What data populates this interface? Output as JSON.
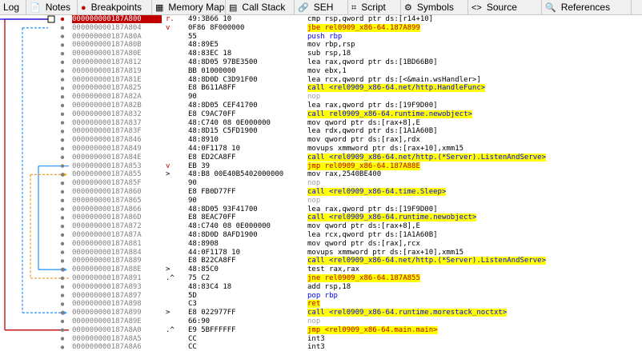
{
  "tabs": [
    {
      "label": "Log",
      "icon": "log-icon"
    },
    {
      "label": "Notes",
      "icon": "notes-icon"
    },
    {
      "label": "Breakpoints",
      "icon": "breakpoint-icon"
    },
    {
      "label": "Memory Map",
      "icon": "memory-map-icon"
    },
    {
      "label": "Call Stack",
      "icon": "call-stack-icon"
    },
    {
      "label": "SEH",
      "icon": "seh-icon"
    },
    {
      "label": "Script",
      "icon": "script-icon"
    },
    {
      "label": "Symbols",
      "icon": "symbols-icon"
    },
    {
      "label": "Source",
      "icon": "source-icon"
    },
    {
      "label": "References",
      "icon": "references-icon"
    }
  ],
  "rows": [
    {
      "addr": "000000000187A800",
      "mark": "r.",
      "bytes": "49:3B66 10",
      "instr": "cmp rsp,qword ptr ds:[r14+10]",
      "style": "cur"
    },
    {
      "addr": "000000000187A804",
      "mark": "v",
      "bytes": "0F86 8F000000",
      "instr": "jbe rel0909_x86-64.187A899",
      "style": "jcc"
    },
    {
      "addr": "000000000187A80A",
      "mark": "",
      "bytes": "55",
      "instr": "push rbp",
      "style": "blue"
    },
    {
      "addr": "000000000187A80B",
      "mark": "",
      "bytes": "48:89E5",
      "instr": "mov rbp,rsp",
      "style": ""
    },
    {
      "addr": "000000000187A80E",
      "mark": "",
      "bytes": "48:83EC 18",
      "instr": "sub rsp,18",
      "style": ""
    },
    {
      "addr": "000000000187A812",
      "mark": "",
      "bytes": "48:8D05 97BE3500",
      "instr": "lea rax,qword ptr ds:[1BD66B0]",
      "style": ""
    },
    {
      "addr": "000000000187A819",
      "mark": "",
      "bytes": "BB 01000000",
      "instr": "mov ebx,1",
      "style": ""
    },
    {
      "addr": "000000000187A81E",
      "mark": "",
      "bytes": "48:8D0D C3D91F00",
      "instr": "lea rcx,qword ptr ds:[<&main.wsHandler>]",
      "style": ""
    },
    {
      "addr": "000000000187A825",
      "mark": "",
      "bytes": "E8 B611A8FF",
      "instr": "call <rel0909_x86-64.net/http.HandleFunc>",
      "style": "call"
    },
    {
      "addr": "000000000187A82A",
      "mark": "",
      "bytes": "90",
      "instr": "nop",
      "style": "nop"
    },
    {
      "addr": "000000000187A82B",
      "mark": "",
      "bytes": "48:8D05 CEF41700",
      "instr": "lea rax,qword ptr ds:[19F9D00]",
      "style": ""
    },
    {
      "addr": "000000000187A832",
      "mark": "",
      "bytes": "E8 C9AC70FF",
      "instr": "call rel0909_x86-64.runtime.newobject>",
      "style": "call"
    },
    {
      "addr": "000000000187A837",
      "mark": "",
      "bytes": "48:C740 08 0E000000",
      "instr": "mov qword ptr ds:[rax+8],E",
      "style": ""
    },
    {
      "addr": "000000000187A83F",
      "mark": "",
      "bytes": "48:8D15 C5FD1900",
      "instr": "lea rdx,qword ptr ds:[1A1A60B]",
      "style": ""
    },
    {
      "addr": "000000000187A846",
      "mark": "",
      "bytes": "48:8910",
      "instr": "mov qword ptr ds:[rax],rdx",
      "style": ""
    },
    {
      "addr": "000000000187A849",
      "mark": "",
      "bytes": "44:0F1178 10",
      "instr": "movups xmmword ptr ds:[rax+10],xmm15",
      "style": ""
    },
    {
      "addr": "000000000187A84E",
      "mark": "",
      "bytes": "E8 ED2CA8FF",
      "instr": "call <rel0909_x86-64.net/http.(*Server).ListenAndServe>",
      "style": "call"
    },
    {
      "addr": "000000000187A853",
      "mark": "v",
      "bytes": "EB 39",
      "instr": "jmp rel0909_x86-64.187A88E",
      "style": "jmp"
    },
    {
      "addr": "000000000187A855",
      "mark": ">",
      "bytes": "48:B8 00E40B5402000000",
      "instr": "mov rax,2540BE400",
      "style": ""
    },
    {
      "addr": "000000000187A85F",
      "mark": "",
      "bytes": "90",
      "instr": "nop",
      "style": "nop"
    },
    {
      "addr": "000000000187A860",
      "mark": "",
      "bytes": "E8 FB0D77FF",
      "instr": "call <rel0909_x86-64.time.Sleep>",
      "style": "call"
    },
    {
      "addr": "000000000187A865",
      "mark": "",
      "bytes": "90",
      "instr": "nop",
      "style": "nop"
    },
    {
      "addr": "000000000187A866",
      "mark": "",
      "bytes": "48:8D05 93F41700",
      "instr": "lea rax,qword ptr ds:[19F9D00]",
      "style": ""
    },
    {
      "addr": "000000000187A86D",
      "mark": "",
      "bytes": "E8 8EAC70FF",
      "instr": "call <rel0909_x86-64.runtime.newobject>",
      "style": "call"
    },
    {
      "addr": "000000000187A872",
      "mark": "",
      "bytes": "48:C740 08 0E000000",
      "instr": "mov qword ptr ds:[rax+8],E",
      "style": ""
    },
    {
      "addr": "000000000187A87A",
      "mark": "",
      "bytes": "48:8D0D 8AFD1900",
      "instr": "lea rcx,qword ptr ds:[1A1A60B]",
      "style": ""
    },
    {
      "addr": "000000000187A881",
      "mark": "",
      "bytes": "48:8908",
      "instr": "mov qword ptr ds:[rax],rcx",
      "style": ""
    },
    {
      "addr": "000000000187A884",
      "mark": "",
      "bytes": "44:0F1178 10",
      "instr": "movups xmmword ptr ds:[rax+10],xmm15",
      "style": ""
    },
    {
      "addr": "000000000187A889",
      "mark": "",
      "bytes": "E8 B22CA8FF",
      "instr": "call <rel0909_x86-64.net/http.(*Server).ListenAndServe>",
      "style": "call"
    },
    {
      "addr": "000000000187A88E",
      "mark": ">",
      "bytes": "48:85C0",
      "instr": "test rax,rax",
      "style": ""
    },
    {
      "addr": "000000000187A891",
      "mark": ".^",
      "bytes": "75 C2",
      "instr": "jne rel0909_x86-64.187A855",
      "style": "jcc"
    },
    {
      "addr": "000000000187A893",
      "mark": "",
      "bytes": "48:83C4 18",
      "instr": "add rsp,18",
      "style": ""
    },
    {
      "addr": "000000000187A897",
      "mark": "",
      "bytes": "5D",
      "instr": "pop rbp",
      "style": "blue"
    },
    {
      "addr": "000000000187A898",
      "mark": "",
      "bytes": "C3",
      "instr": "ret",
      "style": "ret"
    },
    {
      "addr": "000000000187A899",
      "mark": ">",
      "bytes": "E8 022977FF",
      "instr": "call <rel0909_x86-64.runtime.morestack_noctxt>",
      "style": "call"
    },
    {
      "addr": "000000000187A89E",
      "mark": "",
      "bytes": "66:90",
      "instr": "nop",
      "style": "nop"
    },
    {
      "addr": "000000000187A8A0",
      "mark": ".^",
      "bytes": "E9 5BFFFFFF",
      "instr": "jmp <rel0909_x86-64.main.main>",
      "style": "jmp"
    },
    {
      "addr": "000000000187A8A5",
      "mark": "",
      "bytes": "CC",
      "instr": "int3",
      "style": ""
    },
    {
      "addr": "000000000187A8A6",
      "mark": "",
      "bytes": "CC",
      "instr": "int3",
      "style": ""
    }
  ]
}
